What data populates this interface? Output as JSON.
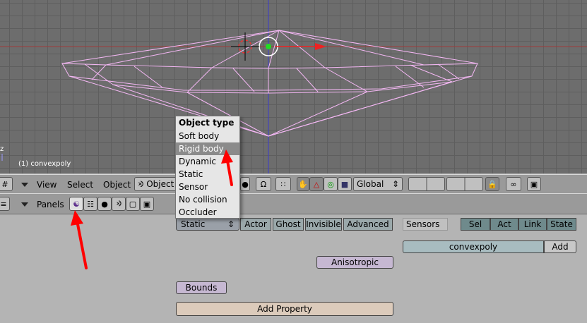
{
  "viewport": {
    "object_label": "(1) convexpoly",
    "axis_label": "z"
  },
  "view3d_header": {
    "menus": [
      "View",
      "Select",
      "Object"
    ],
    "mode_label": "Object",
    "orientation": "Global"
  },
  "buttons_header": {
    "panels_label": "Panels"
  },
  "physics": {
    "type_select": "Static",
    "toggles": [
      "Actor",
      "Ghost",
      "Invisible",
      "Advanced"
    ],
    "anisotropic": "Anisotropic",
    "bounds": "Bounds",
    "add_property": "Add Property"
  },
  "logic": {
    "sensors_label": "Sensors",
    "filters": [
      "Sel",
      "Act",
      "Link",
      "State"
    ],
    "object_name": "convexpoly",
    "add": "Add"
  },
  "menu": {
    "title": "Object type",
    "items": [
      "Soft body",
      "Rigid body",
      "Dynamic",
      "Static",
      "Sensor",
      "No collision",
      "Occluder"
    ],
    "highlighted": "Rigid body"
  },
  "colors": {
    "mesh_wire": "#f5b8f5",
    "arrow": "#ff0000",
    "menu_highlight": "#8b8b8b"
  }
}
